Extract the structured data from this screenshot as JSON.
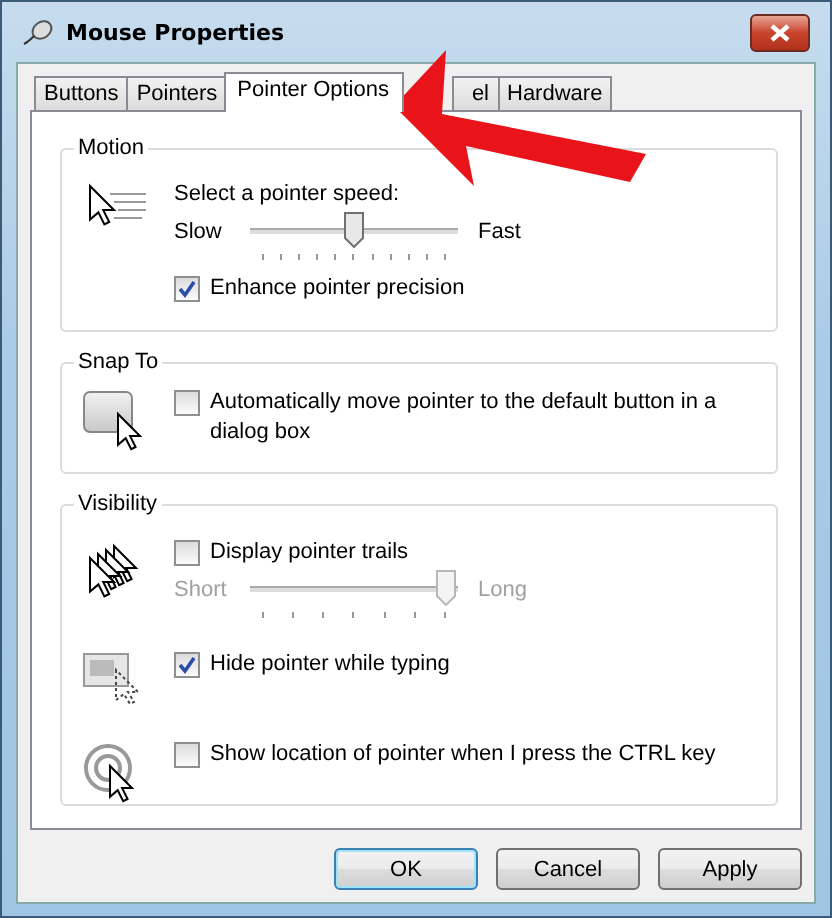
{
  "window": {
    "title": "Mouse Properties"
  },
  "tabs": [
    {
      "label": "Buttons",
      "selected": false
    },
    {
      "label": "Pointers",
      "selected": false
    },
    {
      "label": "Pointer Options",
      "selected": true
    },
    {
      "label": "el",
      "selected": false
    },
    {
      "label": "Hardware",
      "selected": false
    }
  ],
  "groups": [
    {
      "title": "Motion",
      "sections": [
        {
          "items": [
            {
              "kind": "label",
              "text": "Select a pointer speed:"
            },
            {
              "kind": "slider",
              "min_label": "Slow",
              "max_label": "Fast",
              "level": 0.5,
              "disabled": false
            },
            {
              "kind": "checkbox",
              "label": "Enhance pointer precision",
              "checked": true
            }
          ]
        }
      ]
    },
    {
      "title": "Snap To",
      "sections": [
        {
          "items": [
            {
              "kind": "checkbox",
              "label": "Automatically move pointer to the default button in a dialog box",
              "checked": false
            }
          ]
        }
      ]
    },
    {
      "title": "Visibility",
      "sections": [
        {
          "items": [
            {
              "kind": "checkbox",
              "label": "Display pointer trails",
              "checked": false
            },
            {
              "kind": "slider",
              "min_label": "Short",
              "max_label": "Long",
              "level": 1,
              "disabled": true
            }
          ]
        },
        {
          "items": [
            {
              "kind": "checkbox",
              "label": "Hide pointer while typing",
              "checked": true
            }
          ]
        },
        {
          "items": [
            {
              "kind": "checkbox",
              "label": "Show location of pointer when I press the CTRL key",
              "checked": false
            }
          ]
        }
      ]
    }
  ],
  "buttons": [
    {
      "label": "OK",
      "default": true
    },
    {
      "label": "Cancel",
      "default": false
    },
    {
      "label": "Apply",
      "default": false
    }
  ]
}
